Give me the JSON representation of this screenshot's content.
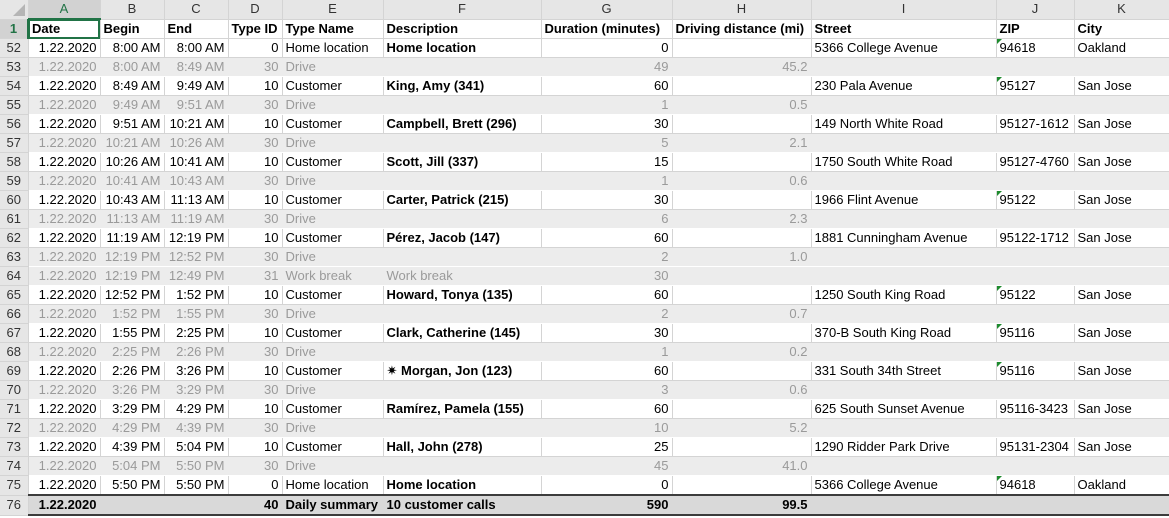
{
  "columns": [
    "A",
    "B",
    "C",
    "D",
    "E",
    "F",
    "G",
    "H",
    "I",
    "J",
    "K"
  ],
  "selected_column": "A",
  "header_row": {
    "row_num": "1",
    "cells": [
      "Date",
      "Begin",
      "End",
      "Type ID",
      "Type Name",
      "Description",
      "Duration (minutes)",
      "Driving distance (mi)",
      "Street",
      "ZIP",
      "City"
    ]
  },
  "rows": [
    {
      "row_num": "52",
      "kind": "cust",
      "date": "1.22.2020",
      "begin": "8:00 AM",
      "end": "8:00 AM",
      "type_id": "0",
      "type_name": "Home location",
      "description": "Home location",
      "duration": "0",
      "distance": "",
      "street": "5366 College Avenue",
      "zip": "94618",
      "zip_flag": true,
      "city": "Oakland"
    },
    {
      "row_num": "53",
      "kind": "drive",
      "date": "1.22.2020",
      "begin": "8:00 AM",
      "end": "8:49 AM",
      "type_id": "30",
      "type_name": "Drive",
      "description": "",
      "duration": "49",
      "distance": "45.2",
      "street": "",
      "zip": "",
      "zip_flag": false,
      "city": ""
    },
    {
      "row_num": "54",
      "kind": "cust",
      "date": "1.22.2020",
      "begin": "8:49 AM",
      "end": "9:49 AM",
      "type_id": "10",
      "type_name": "Customer",
      "description": "King, Amy (341)",
      "duration": "60",
      "distance": "",
      "street": "230 Pala Avenue",
      "zip": "95127",
      "zip_flag": true,
      "city": "San Jose"
    },
    {
      "row_num": "55",
      "kind": "drive",
      "date": "1.22.2020",
      "begin": "9:49 AM",
      "end": "9:51 AM",
      "type_id": "30",
      "type_name": "Drive",
      "description": "",
      "duration": "1",
      "distance": "0.5",
      "street": "",
      "zip": "",
      "zip_flag": false,
      "city": ""
    },
    {
      "row_num": "56",
      "kind": "cust",
      "date": "1.22.2020",
      "begin": "9:51 AM",
      "end": "10:21 AM",
      "type_id": "10",
      "type_name": "Customer",
      "description": "Campbell, Brett (296)",
      "duration": "30",
      "distance": "",
      "street": "149 North White Road",
      "zip": "95127-1612",
      "zip_flag": false,
      "city": "San Jose"
    },
    {
      "row_num": "57",
      "kind": "drive",
      "date": "1.22.2020",
      "begin": "10:21 AM",
      "end": "10:26 AM",
      "type_id": "30",
      "type_name": "Drive",
      "description": "",
      "duration": "5",
      "distance": "2.1",
      "street": "",
      "zip": "",
      "zip_flag": false,
      "city": ""
    },
    {
      "row_num": "58",
      "kind": "cust",
      "date": "1.22.2020",
      "begin": "10:26 AM",
      "end": "10:41 AM",
      "type_id": "10",
      "type_name": "Customer",
      "description": "Scott, Jill (337)",
      "duration": "15",
      "distance": "",
      "street": "1750 South White Road",
      "zip": "95127-4760",
      "zip_flag": false,
      "city": "San Jose"
    },
    {
      "row_num": "59",
      "kind": "drive",
      "date": "1.22.2020",
      "begin": "10:41 AM",
      "end": "10:43 AM",
      "type_id": "30",
      "type_name": "Drive",
      "description": "",
      "duration": "1",
      "distance": "0.6",
      "street": "",
      "zip": "",
      "zip_flag": false,
      "city": ""
    },
    {
      "row_num": "60",
      "kind": "cust",
      "date": "1.22.2020",
      "begin": "10:43 AM",
      "end": "11:13 AM",
      "type_id": "10",
      "type_name": "Customer",
      "description": "Carter, Patrick (215)",
      "duration": "30",
      "distance": "",
      "street": "1966 Flint Avenue",
      "zip": "95122",
      "zip_flag": true,
      "city": "San Jose"
    },
    {
      "row_num": "61",
      "kind": "drive",
      "date": "1.22.2020",
      "begin": "11:13 AM",
      "end": "11:19 AM",
      "type_id": "30",
      "type_name": "Drive",
      "description": "",
      "duration": "6",
      "distance": "2.3",
      "street": "",
      "zip": "",
      "zip_flag": false,
      "city": ""
    },
    {
      "row_num": "62",
      "kind": "cust",
      "date": "1.22.2020",
      "begin": "11:19 AM",
      "end": "12:19 PM",
      "type_id": "10",
      "type_name": "Customer",
      "description": "Pérez, Jacob (147)",
      "duration": "60",
      "distance": "",
      "street": "1881 Cunningham Avenue",
      "zip": "95122-1712",
      "zip_flag": false,
      "city": "San Jose"
    },
    {
      "row_num": "63",
      "kind": "drive",
      "date": "1.22.2020",
      "begin": "12:19 PM",
      "end": "12:52 PM",
      "type_id": "30",
      "type_name": "Drive",
      "description": "",
      "duration": "2",
      "distance": "1.0",
      "street": "",
      "zip": "",
      "zip_flag": false,
      "city": ""
    },
    {
      "row_num": "64",
      "kind": "drive",
      "date": "1.22.2020",
      "begin": "12:19 PM",
      "end": "12:49 PM",
      "type_id": "31",
      "type_name": "Work break",
      "description": "Work break",
      "duration": "30",
      "distance": "",
      "street": "",
      "zip": "",
      "zip_flag": false,
      "city": ""
    },
    {
      "row_num": "65",
      "kind": "cust",
      "date": "1.22.2020",
      "begin": "12:52 PM",
      "end": "1:52 PM",
      "type_id": "10",
      "type_name": "Customer",
      "description": "Howard, Tonya (135)",
      "duration": "60",
      "distance": "",
      "street": "1250 South King Road",
      "zip": "95122",
      "zip_flag": true,
      "city": "San Jose"
    },
    {
      "row_num": "66",
      "kind": "drive",
      "date": "1.22.2020",
      "begin": "1:52 PM",
      "end": "1:55 PM",
      "type_id": "30",
      "type_name": "Drive",
      "description": "",
      "duration": "2",
      "distance": "0.7",
      "street": "",
      "zip": "",
      "zip_flag": false,
      "city": ""
    },
    {
      "row_num": "67",
      "kind": "cust",
      "date": "1.22.2020",
      "begin": "1:55 PM",
      "end": "2:25 PM",
      "type_id": "10",
      "type_name": "Customer",
      "description": "Clark, Catherine (145)",
      "duration": "30",
      "distance": "",
      "street": "370-B South King Road",
      "zip": "95116",
      "zip_flag": true,
      "city": "San Jose"
    },
    {
      "row_num": "68",
      "kind": "drive",
      "date": "1.22.2020",
      "begin": "2:25 PM",
      "end": "2:26 PM",
      "type_id": "30",
      "type_name": "Drive",
      "description": "",
      "duration": "1",
      "distance": "0.2",
      "street": "",
      "zip": "",
      "zip_flag": false,
      "city": ""
    },
    {
      "row_num": "69",
      "kind": "cust",
      "date": "1.22.2020",
      "begin": "2:26 PM",
      "end": "3:26 PM",
      "type_id": "10",
      "type_name": "Customer",
      "description": "✷ Morgan, Jon (123)",
      "duration": "60",
      "distance": "",
      "street": "331 South 34th Street",
      "zip": "95116",
      "zip_flag": true,
      "city": "San Jose"
    },
    {
      "row_num": "70",
      "kind": "drive",
      "date": "1.22.2020",
      "begin": "3:26 PM",
      "end": "3:29 PM",
      "type_id": "30",
      "type_name": "Drive",
      "description": "",
      "duration": "3",
      "distance": "0.6",
      "street": "",
      "zip": "",
      "zip_flag": false,
      "city": ""
    },
    {
      "row_num": "71",
      "kind": "cust",
      "date": "1.22.2020",
      "begin": "3:29 PM",
      "end": "4:29 PM",
      "type_id": "10",
      "type_name": "Customer",
      "description": "Ramírez, Pamela (155)",
      "duration": "60",
      "distance": "",
      "street": "625 South Sunset Avenue",
      "zip": "95116-3423",
      "zip_flag": false,
      "city": "San Jose"
    },
    {
      "row_num": "72",
      "kind": "drive",
      "date": "1.22.2020",
      "begin": "4:29 PM",
      "end": "4:39 PM",
      "type_id": "30",
      "type_name": "Drive",
      "description": "",
      "duration": "10",
      "distance": "5.2",
      "street": "",
      "zip": "",
      "zip_flag": false,
      "city": ""
    },
    {
      "row_num": "73",
      "kind": "cust",
      "date": "1.22.2020",
      "begin": "4:39 PM",
      "end": "5:04 PM",
      "type_id": "10",
      "type_name": "Customer",
      "description": "Hall, John (278)",
      "duration": "25",
      "distance": "",
      "street": "1290 Ridder Park Drive",
      "zip": "95131-2304",
      "zip_flag": false,
      "city": "San Jose"
    },
    {
      "row_num": "74",
      "kind": "drive",
      "date": "1.22.2020",
      "begin": "5:04 PM",
      "end": "5:50 PM",
      "type_id": "30",
      "type_name": "Drive",
      "description": "",
      "duration": "45",
      "distance": "41.0",
      "street": "",
      "zip": "",
      "zip_flag": false,
      "city": ""
    },
    {
      "row_num": "75",
      "kind": "cust",
      "date": "1.22.2020",
      "begin": "5:50 PM",
      "end": "5:50 PM",
      "type_id": "0",
      "type_name": "Home location",
      "description": "Home location",
      "duration": "0",
      "distance": "",
      "street": "5366 College Avenue",
      "zip": "94618",
      "zip_flag": true,
      "city": "Oakland"
    },
    {
      "row_num": "76",
      "kind": "summary",
      "date": "1.22.2020",
      "begin": "",
      "end": "",
      "type_id": "40",
      "type_name": "Daily summary",
      "description": "10 customer calls",
      "duration": "590",
      "distance": "99.5",
      "street": "",
      "zip": "",
      "zip_flag": false,
      "city": ""
    }
  ]
}
